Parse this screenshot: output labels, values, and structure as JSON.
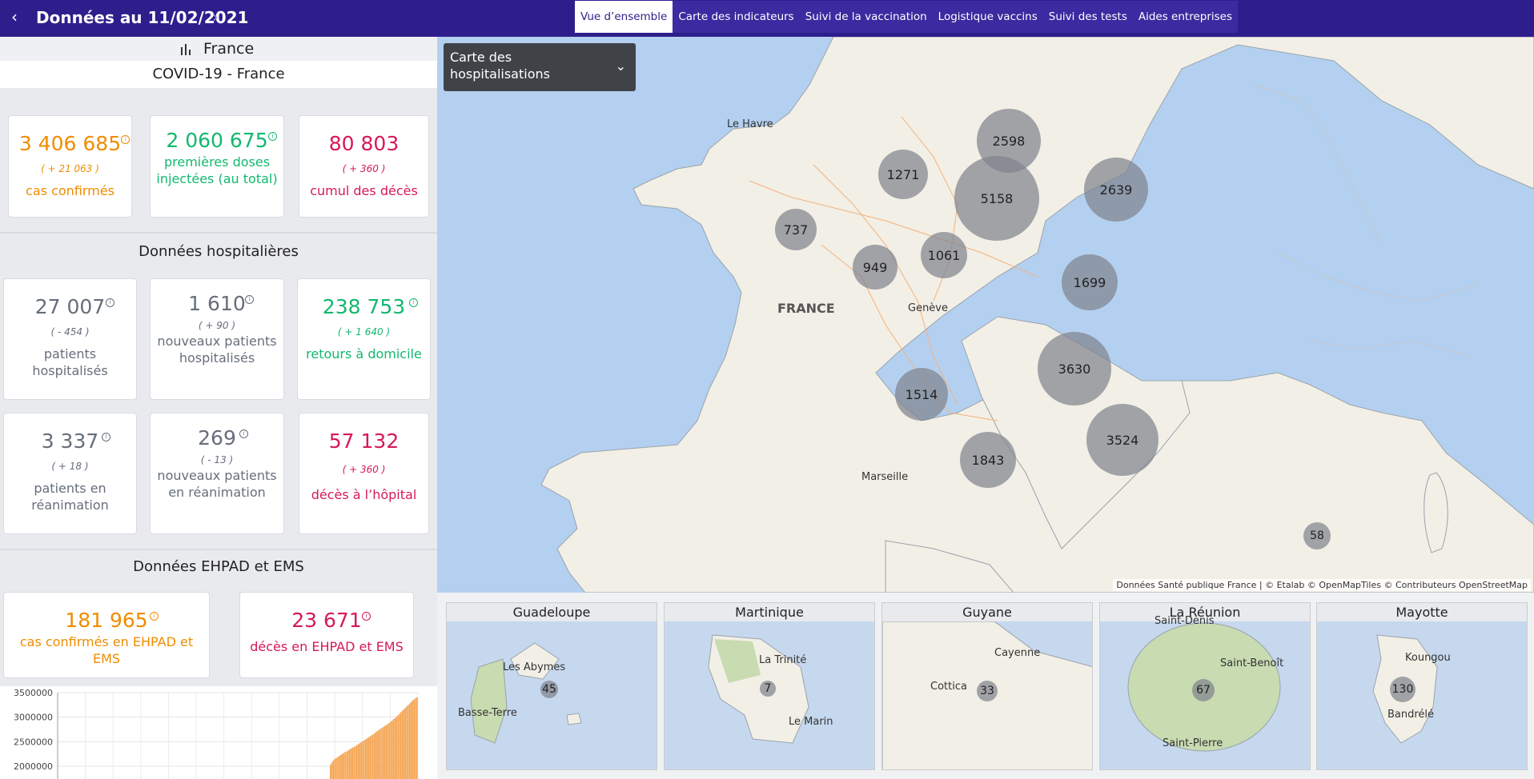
{
  "header": {
    "prev_icon": "chevron-left-icon",
    "title": "Données au 11/02/2021",
    "next_icon": "chevron-right-icon",
    "tabs": [
      {
        "label": "Vue d’ensemble",
        "active": true
      },
      {
        "label": "Carte des indicateurs",
        "active": false
      },
      {
        "label": "Suivi de la vaccination",
        "active": false
      },
      {
        "label": "Logistique vaccins",
        "active": false
      },
      {
        "label": "Suivi des tests",
        "active": false
      },
      {
        "label": "Aides entreprises",
        "active": false
      }
    ]
  },
  "sidebar": {
    "region_icon": "bar-chart-icon",
    "region": "France",
    "covid_title": "COVID-19 - France",
    "cards_top": [
      {
        "value": "3 406 685",
        "delta": "( + 21 063 )",
        "label": "cas confirmés",
        "color": "#f08c00"
      },
      {
        "value": "2 060 675",
        "label": "premières doses injectées (au total)",
        "color": "#12b86e"
      },
      {
        "value": "80 803",
        "delta": "( + 360 )",
        "label": "cumul des décès",
        "color": "#d6185a"
      }
    ],
    "hospital_title": "Données hospitalières",
    "hospital_cards": [
      {
        "value": "27 007",
        "delta": "( - 454 )",
        "label": "patients hospitalisés"
      },
      {
        "value": "1 610",
        "delta": "( + 90 )",
        "label": "nouveaux patients hospitalisés"
      },
      {
        "value": "238 753",
        "delta": "( + 1 640 )",
        "label": "retours à domicile"
      },
      {
        "value": "3 337",
        "delta": "( + 18 )",
        "label": "patients en réanimation"
      },
      {
        "value": "269",
        "delta": "( - 13 )",
        "label": "nouveaux patients en réanimation"
      },
      {
        "value": "57 132",
        "delta": "( + 360 )",
        "label": "décès à l’hôpital"
      }
    ],
    "ehpad_title": "Données EHPAD et EMS",
    "ehpad_cards": [
      {
        "value": "181 965",
        "label": "cas confirmés en EHPAD et EMS"
      },
      {
        "value": "23 671",
        "label": "décès en EHPAD et EMS"
      }
    ]
  },
  "chart_data": {
    "type": "bar",
    "yticks": [
      "3500000",
      "3000000",
      "2500000",
      "2000000"
    ],
    "ylim": [
      2000000,
      3500000
    ],
    "x": [
      0,
      1,
      2,
      3,
      4,
      5,
      6,
      7,
      8,
      9,
      10,
      11,
      12,
      13,
      14,
      15,
      16,
      17,
      18,
      19,
      20,
      21,
      22,
      23,
      24,
      25,
      26,
      27,
      28,
      29,
      30,
      31,
      32,
      33,
      34,
      35,
      36,
      37,
      38,
      39,
      40,
      41,
      42,
      43,
      44,
      45,
      46,
      47,
      48,
      49,
      50,
      51,
      52,
      53,
      54,
      55,
      56,
      57,
      58,
      59
    ],
    "values": [
      2030000,
      2080000,
      2120000,
      2150000,
      2170000,
      2190000,
      2210000,
      2230000,
      2250000,
      2270000,
      2290000,
      2300000,
      2320000,
      2340000,
      2360000,
      2380000,
      2390000,
      2410000,
      2430000,
      2450000,
      2470000,
      2490000,
      2510000,
      2530000,
      2550000,
      2570000,
      2590000,
      2610000,
      2630000,
      2650000,
      2670000,
      2700000,
      2720000,
      2740000,
      2760000,
      2780000,
      2800000,
      2820000,
      2840000,
      2860000,
      2880000,
      2910000,
      2930000,
      2960000,
      2980000,
      3010000,
      3040000,
      3070000,
      3100000,
      3130000,
      3160000,
      3190000,
      3220000,
      3250000,
      3280000,
      3310000,
      3340000,
      3360000,
      3390000,
      3406685
    ],
    "color": "#f4a14a"
  },
  "map": {
    "dropdown_label": "Carte des hospitalisations",
    "dropdown_icon": "chevron-down-icon",
    "country_label": "FRANCE",
    "city_labels": {
      "le_havre": "Le Havre",
      "geneve": "Genève",
      "marseille": "Marseille"
    },
    "bubbles": [
      "2598",
      "1271",
      "5158",
      "2639",
      "737",
      "949",
      "1061",
      "1699",
      "3630",
      "1514",
      "3524",
      "1843",
      "58"
    ],
    "attribution": "Données Santé publique France | © Etalab © OpenMapTiles © Contributeurs OpenStreetMap"
  },
  "insets": [
    {
      "title": "Guadeloupe",
      "value": "45",
      "labels": [
        "Les Abymes",
        "Basse-Terre"
      ]
    },
    {
      "title": "Martinique",
      "value": "7",
      "labels": [
        "La Trinité",
        "Le Marin"
      ]
    },
    {
      "title": "Guyane",
      "value": "33",
      "labels": [
        "Cayenne",
        "Cottica"
      ]
    },
    {
      "title": "La Réunion",
      "value": "67",
      "labels": [
        "Saint-Denis",
        "Saint-Benoît",
        "Saint-Pierre"
      ]
    },
    {
      "title": "Mayotte",
      "value": "130",
      "labels": [
        "Koungou",
        "Bandrélé"
      ]
    }
  ]
}
